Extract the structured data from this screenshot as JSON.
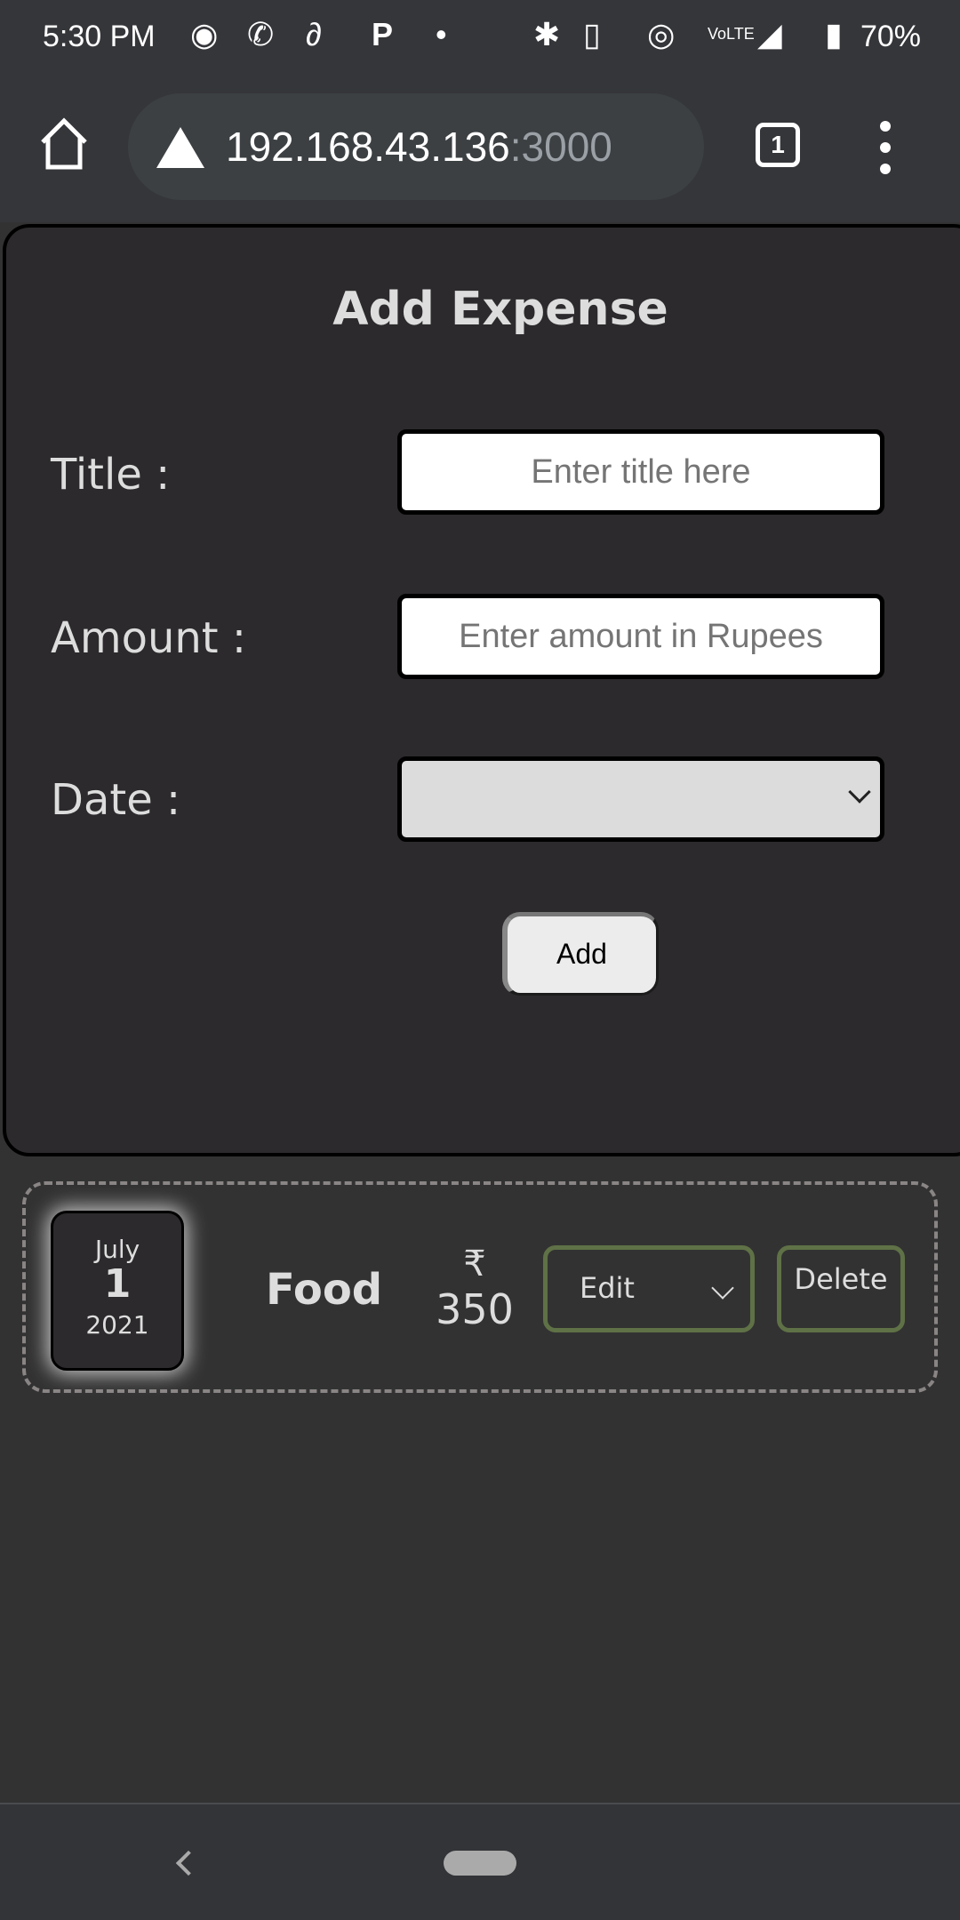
{
  "status_bar": {
    "time": "5:30 PM",
    "notification_icons": [
      "spotify-icon",
      "whatsapp-icon",
      "airtel-icon",
      "paytm-icon",
      "dot-icon"
    ],
    "system_icons": [
      "bluetooth-icon",
      "vibrate-icon",
      "hotspot-icon",
      "volte-icon",
      "4g-signal-icon",
      "battery-charging-icon"
    ],
    "battery": "70%"
  },
  "browser": {
    "url_host": "192.168.43.136",
    "url_port": ":3000",
    "tab_count": "1"
  },
  "form": {
    "title": "Add Expense",
    "title_label": "Title :",
    "title_placeholder": "Enter title here",
    "amount_label": "Amount :",
    "amount_placeholder": "Enter amount in Rupees",
    "date_label": "Date :",
    "date_value": "",
    "add_label": "Add"
  },
  "expenses": [
    {
      "month": "July",
      "day": "1",
      "year": "2021",
      "title": "Food",
      "currency": "₹",
      "amount": "350",
      "edit_label": "Edit",
      "delete_label": "Delete"
    }
  ],
  "colors": {
    "button_border": "#5f7146",
    "background": "#323232",
    "card": "#2c2a2c"
  }
}
